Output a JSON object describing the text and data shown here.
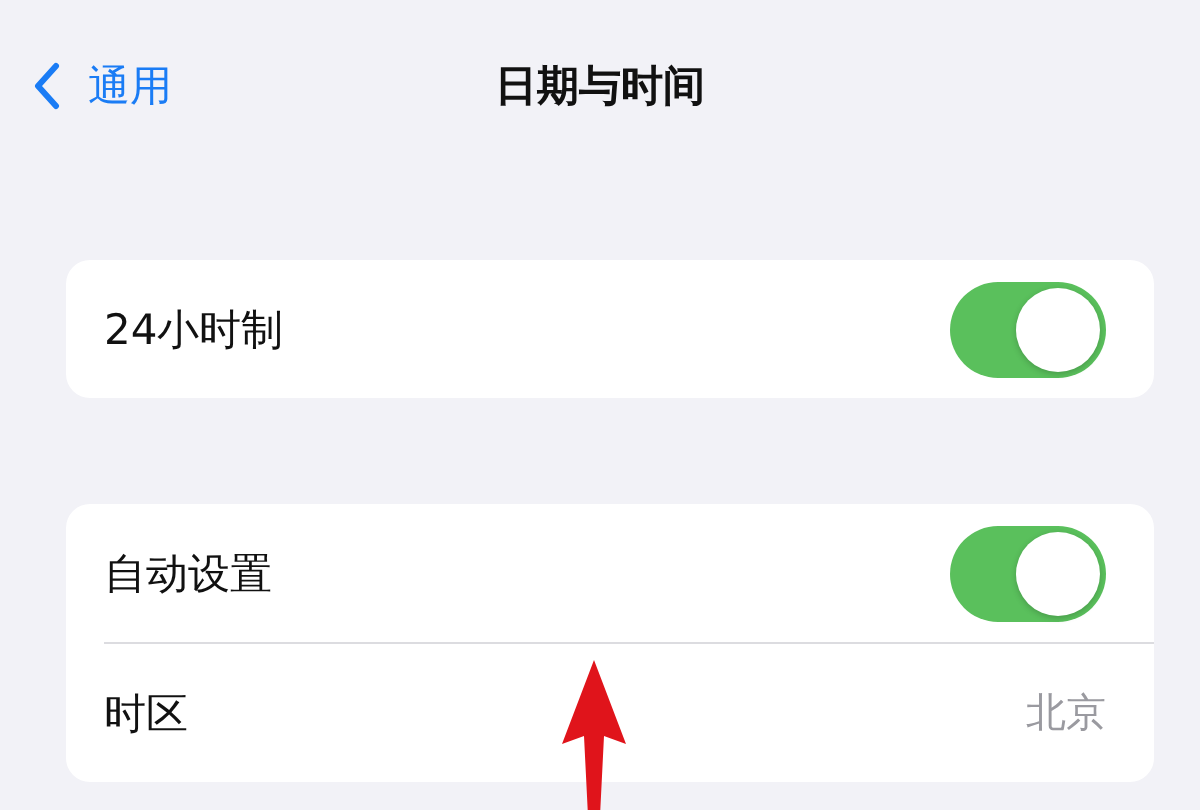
{
  "nav": {
    "back_label": "通用",
    "title": "日期与时间"
  },
  "groups": [
    {
      "rows": [
        {
          "kind": "toggle",
          "label": "24小时制",
          "on": true
        }
      ]
    },
    {
      "rows": [
        {
          "kind": "toggle",
          "label": "自动设置",
          "on": true
        },
        {
          "kind": "value",
          "label": "时区",
          "value": "北京"
        }
      ]
    }
  ]
}
